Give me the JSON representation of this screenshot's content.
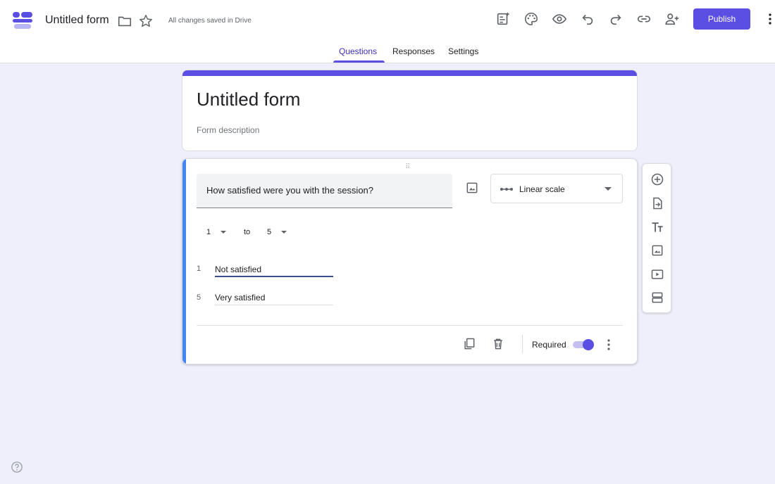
{
  "header": {
    "doc_title": "Untitled form",
    "save_status": "All changes saved in Drive",
    "publish_label": "Publish"
  },
  "tabs": [
    {
      "label": "Questions",
      "active": true
    },
    {
      "label": "Responses",
      "active": false
    },
    {
      "label": "Settings",
      "active": false
    }
  ],
  "form": {
    "title": "Untitled form",
    "description_placeholder": "Form description"
  },
  "question": {
    "text": "How satisfied were you with the session?",
    "type_label": "Linear scale",
    "scale_from": "1",
    "scale_to_word": "to",
    "scale_to": "5",
    "low_num": "1",
    "low_label": "Not satisfied",
    "high_num": "5",
    "high_label": "Very satisfied",
    "required_label": "Required",
    "required": true
  },
  "colors": {
    "accent": "#5b4fe3",
    "active_card_bar": "#4285f4",
    "background": "#efeffb"
  }
}
